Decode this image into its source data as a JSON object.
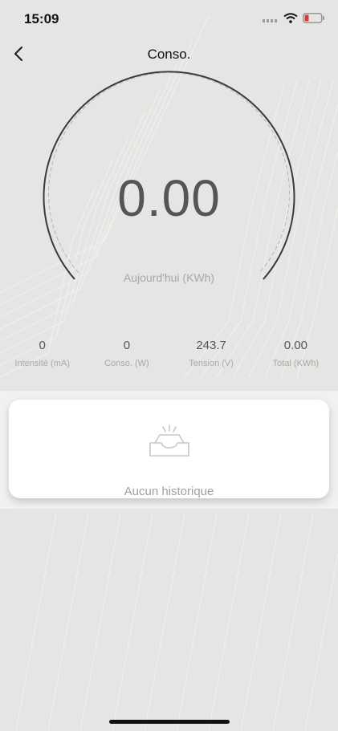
{
  "status_bar": {
    "time": "15:09",
    "icons": [
      "signal-icon",
      "wifi-icon",
      "battery-low-icon"
    ],
    "battery_color": "#e03a2f"
  },
  "nav": {
    "title": "Conso.",
    "back_icon": "chevron-left-icon"
  },
  "gauge": {
    "value": "0.00",
    "caption": "Aujourd'hui (KWh)",
    "level": 0
  },
  "stats": [
    {
      "value": "0",
      "label": "Intensité (mA)"
    },
    {
      "value": "0",
      "label": "Conso. (W)"
    },
    {
      "value": "243.7",
      "label": "Tension (V)"
    },
    {
      "value": "0.00",
      "label": "Total (KWh)"
    }
  ],
  "history": {
    "empty_text": "Aucun historique",
    "empty_icon": "empty-inbox-icon"
  },
  "colors": {
    "background": "#e5e5e3",
    "gauge_arc": "#3a3a3a",
    "card": "#ffffff"
  }
}
